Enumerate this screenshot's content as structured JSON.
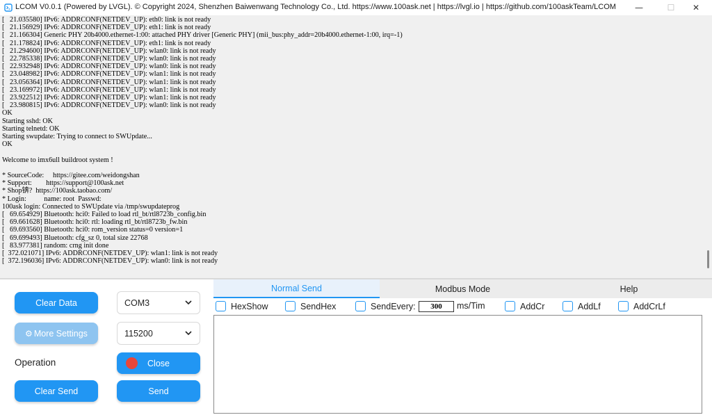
{
  "window": {
    "title": "LCOM V0.0.1 (Powered by LVGL).  © Copyright 2024, Shenzhen Baiwenwang Technology Co., Ltd.   https://www.100ask.net | https://lvgl.io | https://github.com/100askTeam/LCOM",
    "minimize_glyph": "—",
    "maximize_glyph": "☐",
    "close_glyph": "✕"
  },
  "terminal": {
    "lines": [
      "[   21.035580] IPv6: ADDRCONF(NETDEV_UP): eth0: link is not ready",
      "[   21.156929] IPv6: ADDRCONF(NETDEV_UP): eth1: link is not ready",
      "[   21.166304] Generic PHY 20b4000.ethernet-1:00: attached PHY driver [Generic PHY] (mii_bus:phy_addr=20b4000.ethernet-1:00, irq=-1)",
      "[   21.178824] IPv6: ADDRCONF(NETDEV_UP): eth1: link is not ready",
      "[   21.294600] IPv6: ADDRCONF(NETDEV_UP): wlan0: link is not ready",
      "[   22.785338] IPv6: ADDRCONF(NETDEV_UP): wlan0: link is not ready",
      "[   22.932948] IPv6: ADDRCONF(NETDEV_UP): wlan0: link is not ready",
      "[   23.048982] IPv6: ADDRCONF(NETDEV_UP): wlan1: link is not ready",
      "[   23.056364] IPv6: ADDRCONF(NETDEV_UP): wlan1: link is not ready",
      "[   23.169972] IPv6: ADDRCONF(NETDEV_UP): wlan1: link is not ready",
      "[   23.922512] IPv6: ADDRCONF(NETDEV_UP): wlan1: link is not ready",
      "[   23.980815] IPv6: ADDRCONF(NETDEV_UP): wlan0: link is not ready",
      "OK",
      "Starting sshd: OK",
      "Starting telnetd: OK",
      "Starting swupdate: Trying to connect to SWUpdate...",
      "OK",
      "",
      "Welcome to imx6ull buildroot system !",
      "",
      "* SourceCode:     https://gitee.com/weidongshan",
      "* Support:        https://support@100ask.net",
      "* Shop锛?  https://100ask.taobao.com/",
      "* Login:          name: root  Passwd:",
      "100ask login: Connected to SWUpdate via /tmp/swupdateprog",
      "[   69.654929] Bluetooth: hci0: Failed to load rtl_bt/rtl8723b_config.bin",
      "[   69.661628] Bluetooth: hci0: rtl: loading rtl_bt/rtl8723b_fw.bin",
      "[   69.693560] Bluetooth: hci0: rom_version status=0 version=1",
      "[   69.699493] Bluetooth: cfg_sz 0, total size 22768",
      "[   83.977381] random: crng init done",
      "[  372.021071] IPv6: ADDRCONF(NETDEV_UP): wlan1: link is not ready",
      "[  372.196036] IPv6: ADDRCONF(NETDEV_UP): wlan0: link is not ready"
    ]
  },
  "controls": {
    "clear_data": "Clear Data",
    "more_settings": "More Settings",
    "port": "COM3",
    "baud": "115200",
    "operation_label": "Operation",
    "close": "Close",
    "clear_send": "Clear Send",
    "send": "Send"
  },
  "tabs": [
    {
      "label": "Normal Send",
      "active": true
    },
    {
      "label": "Modbus Mode",
      "active": false
    },
    {
      "label": "Help",
      "active": false
    }
  ],
  "options": {
    "hexshow": "HexShow",
    "sendhex": "SendHex",
    "sendevery": "SendEvery:",
    "interval": "300",
    "unit": "ms/Tim",
    "addcr": "AddCr",
    "addlf": "AddLf",
    "addcrlf": "AddCrLf"
  },
  "send_text": "",
  "colors": {
    "accent": "#2196f3",
    "accent_disabled": "#8ec4f0",
    "status_led": "#e8463a",
    "terminal_bg": "#f0f0f0"
  }
}
